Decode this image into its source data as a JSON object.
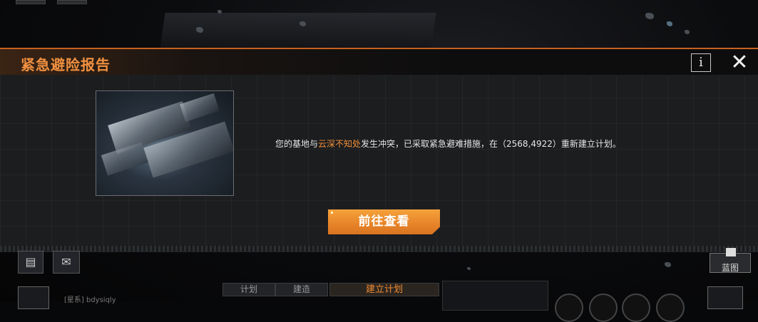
{
  "dialog": {
    "title": "紧急避险报告",
    "info_label": "i",
    "close_label": "✕",
    "message_prefix": "您的基地与",
    "message_highlight": "云深不知处",
    "message_suffix": "发生冲突，已采取紧急避难措施，在（2568,4922）重新建立计划。",
    "action_label": "前往查看",
    "colors": {
      "accent": "#f09040",
      "button": "#e8862b"
    }
  },
  "hud": {
    "blueprint_label": "蓝图",
    "tabs": [
      "计划",
      "建造",
      "建立计划"
    ],
    "username": "[星系] bdysiqly"
  }
}
